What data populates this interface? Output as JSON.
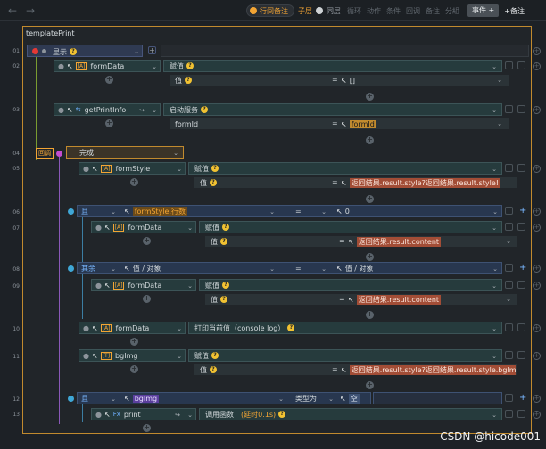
{
  "toolbar": {
    "back": "←",
    "forward": "→",
    "inline_notes": "行间备注",
    "sublayer": "子层",
    "same_layer": "同层",
    "loop": "循环",
    "action": "动作",
    "condition": "条件",
    "callback": "回调",
    "note": "备注",
    "branch": "分組",
    "event": "事件",
    "event_add": "+",
    "add_note": "备注"
  },
  "panel": {
    "title": "templatePrint"
  },
  "rows": {
    "r01": {
      "num": "01",
      "label": "显示"
    },
    "r02": {
      "num": "02",
      "target": "formData",
      "op": "赋值",
      "sub_label": "值",
      "sub_value": "[]"
    },
    "r03": {
      "num": "03",
      "target": "getPrintInfo",
      "op": "启动服务",
      "sub_label": "formId",
      "sub_value": "formId"
    },
    "r04": {
      "num": "04",
      "badge": "回调",
      "label": "完成"
    },
    "r05": {
      "num": "05",
      "target": "formStyle",
      "op": "赋值",
      "sub_label": "值",
      "sub_value": "返回结果.result.style?返回结果.result.style!"
    },
    "r06": {
      "num": "06",
      "kw": "且",
      "field": "formStyle.行数",
      "cmp": "=",
      "value": "0"
    },
    "r07": {
      "num": "07",
      "target": "formData",
      "op": "赋值",
      "sub_label": "值",
      "sub_value": "返回结果.result.content"
    },
    "r08": {
      "num": "08",
      "kw": "其余",
      "field": "值 / 对象",
      "cmp": "=",
      "value": "值 / 对象"
    },
    "r09": {
      "num": "09",
      "target": "formData",
      "op": "赋值",
      "sub_label": "值",
      "sub_value": "返回结果.result.content"
    },
    "r10": {
      "num": "10",
      "target": "formData",
      "op": "打印当前值（console log）"
    },
    "r11": {
      "num": "11",
      "target": "bgImg",
      "op": "赋值",
      "sub_label": "值",
      "sub_value": "返回结果.result.style?返回结果.result.style.bgIm"
    },
    "r12": {
      "num": "12",
      "kw": "且",
      "field": "bgImg",
      "cmp": "类型为",
      "value": "空"
    },
    "r13": {
      "num": "13",
      "target": "print",
      "op": "调用函数",
      "extra": "(延时0.1s)"
    }
  },
  "watermark": "CSDN @hicode001"
}
